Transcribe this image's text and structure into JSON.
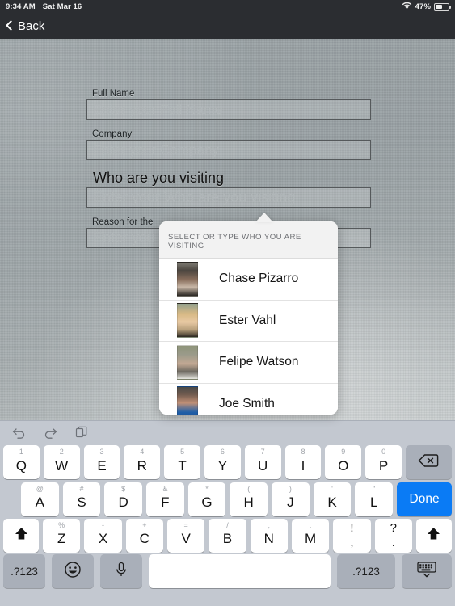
{
  "statusbar": {
    "time": "9:34 AM",
    "date": "Sat Mar 16",
    "wifi_icon": "wifi-icon",
    "battery_percent": "47%",
    "battery_icon": "battery-icon"
  },
  "navbar": {
    "back_label": "Back",
    "back_icon": "chevron-left-icon"
  },
  "form": {
    "fields": [
      {
        "label": "Full Name",
        "placeholder": "Enter your Full Name"
      },
      {
        "label": "Company",
        "placeholder": "Enter your Company"
      },
      {
        "label": "Who are you visiting",
        "placeholder": "Enter your Who are you visiting"
      },
      {
        "label": "Reason for the",
        "placeholder": "Enter you"
      }
    ]
  },
  "popover": {
    "title": "SELECT OR TYPE WHO YOU ARE VISITING",
    "people": [
      {
        "name": "Chase Pizarro",
        "avatar": "avatar-chase-pizarro"
      },
      {
        "name": "Ester Vahl",
        "avatar": "avatar-ester-vahl"
      },
      {
        "name": "Felipe Watson",
        "avatar": "avatar-felipe-watson"
      },
      {
        "name": "Joe Smith",
        "avatar": "avatar-joe-smith"
      }
    ]
  },
  "keyboard": {
    "toolbar": [
      {
        "name": "undo-icon",
        "label": "undo"
      },
      {
        "name": "redo-icon",
        "label": "redo"
      },
      {
        "name": "paste-icon",
        "label": "paste"
      }
    ],
    "row1": [
      {
        "main": "Q",
        "alt": "1"
      },
      {
        "main": "W",
        "alt": "2"
      },
      {
        "main": "E",
        "alt": "3"
      },
      {
        "main": "R",
        "alt": "4"
      },
      {
        "main": "T",
        "alt": "5"
      },
      {
        "main": "Y",
        "alt": "6"
      },
      {
        "main": "U",
        "alt": "7"
      },
      {
        "main": "I",
        "alt": "8"
      },
      {
        "main": "O",
        "alt": "9"
      },
      {
        "main": "P",
        "alt": "0"
      }
    ],
    "backspace_icon": "backspace-icon",
    "row2": [
      {
        "main": "A",
        "alt": "@"
      },
      {
        "main": "S",
        "alt": "#"
      },
      {
        "main": "D",
        "alt": "$"
      },
      {
        "main": "F",
        "alt": "&"
      },
      {
        "main": "G",
        "alt": "*"
      },
      {
        "main": "H",
        "alt": "("
      },
      {
        "main": "J",
        "alt": ")"
      },
      {
        "main": "K",
        "alt": "'"
      },
      {
        "main": "L",
        "alt": "\""
      }
    ],
    "done_label": "Done",
    "row3": [
      {
        "main": "Z",
        "alt": "%"
      },
      {
        "main": "X",
        "alt": "-"
      },
      {
        "main": "C",
        "alt": "+"
      },
      {
        "main": "V",
        "alt": "="
      },
      {
        "main": "B",
        "alt": "/"
      },
      {
        "main": "N",
        "alt": ";"
      },
      {
        "main": "M",
        "alt": ":"
      }
    ],
    "shift_icon": "shift-icon",
    "punct1_top": "!",
    "punct1_bottom": ",",
    "punct2_top": "?",
    "punct2_bottom": ".",
    "row4": {
      "sym_left": ".?123",
      "emoji_icon": "emoji-icon",
      "mic_icon": "microphone-icon",
      "space": "",
      "sym_right": ".?123",
      "dismiss_icon": "hide-keyboard-icon"
    }
  },
  "colors": {
    "accent": "#0a7bf5",
    "keyboard_bg": "#c3c8d0",
    "navbar_bg": "#2b2d31",
    "key_gray": "#a9afb9"
  }
}
